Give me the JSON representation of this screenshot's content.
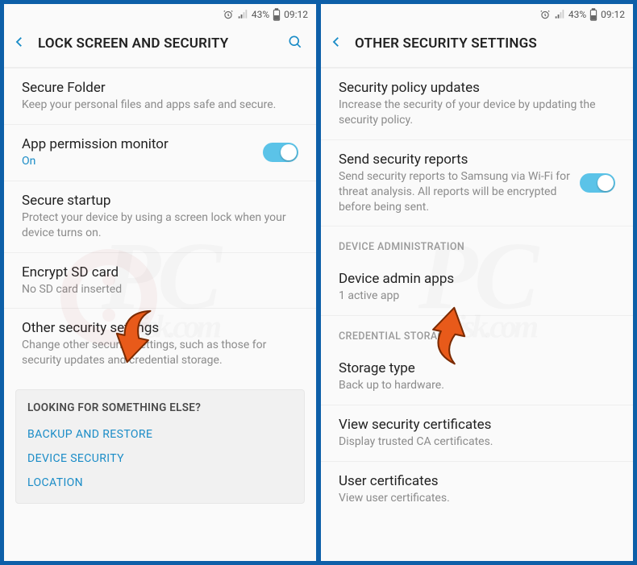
{
  "statusbar": {
    "battery": "43%",
    "time": "09:12"
  },
  "left": {
    "title": "LOCK SCREEN AND SECURITY",
    "secure_folder": {
      "label": "Secure Folder",
      "sub": "Keep your personal files and apps safe and secure."
    },
    "app_perm": {
      "label": "App permission monitor",
      "state": "On"
    },
    "secure_startup": {
      "label": "Secure startup",
      "sub": "Protect your device by using a screen lock when your device turns on."
    },
    "encrypt": {
      "label": "Encrypt SD card",
      "sub": "No SD card inserted"
    },
    "other": {
      "label": "Other security settings",
      "sub": "Change other security settings, such as those for security updates and credential storage."
    },
    "looking": {
      "hdr": "LOOKING FOR SOMETHING ELSE?",
      "links": [
        "BACKUP AND RESTORE",
        "DEVICE SECURITY",
        "LOCATION"
      ]
    }
  },
  "right": {
    "title": "OTHER SECURITY SETTINGS",
    "policy": {
      "label": "Security policy updates",
      "sub": "Increase the security of your device by updating the security policy."
    },
    "reports": {
      "label": "Send security reports",
      "sub": "Send security reports to Samsung via Wi-Fi for threat analysis. All reports will be encrypted before being sent."
    },
    "section_admin": "DEVICE ADMINISTRATION",
    "admin_apps": {
      "label": "Device admin apps",
      "sub": "1 active app"
    },
    "section_cred": "CREDENTIAL STORAGE",
    "storage": {
      "label": "Storage type",
      "sub": "Back up to hardware."
    },
    "view_cert": {
      "label": "View security certificates",
      "sub": "Display trusted CA certificates."
    },
    "user_cert": {
      "label": "User certificates",
      "sub": "View user certificates."
    }
  }
}
